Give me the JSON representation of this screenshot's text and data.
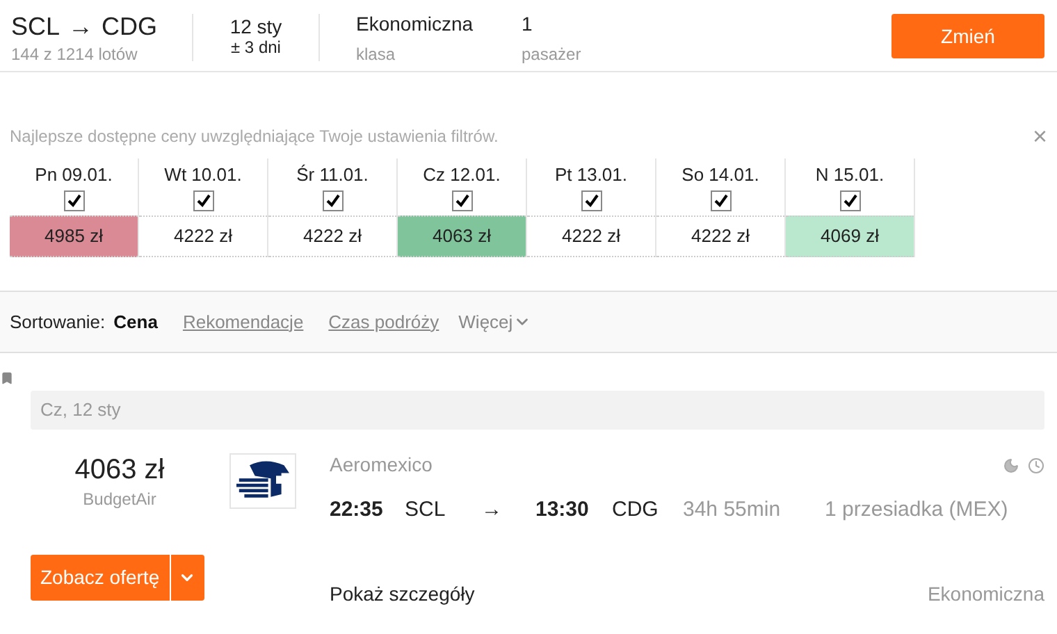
{
  "search_summary": {
    "route": {
      "from": "SCL",
      "arrow": "→",
      "to": "CDG",
      "count": "144 z 1214 lotów"
    },
    "date": {
      "value": "12 sty",
      "flex": "± 3 dni"
    },
    "cabin": {
      "value": "Ekonomiczna",
      "label": "klasa"
    },
    "passengers": {
      "value": "1",
      "label": "pasażer"
    },
    "change_button": "Zmień"
  },
  "price_calendar": {
    "note": "Najlepsze dostępne ceny uwzględniające Twoje ustawienia filtrów.",
    "close": "×",
    "days": [
      {
        "label": "Pn 09.01.",
        "checked": true,
        "price": "4985 zł",
        "color": "#d98a94"
      },
      {
        "label": "Wt 10.01.",
        "checked": true,
        "price": "4222 zł",
        "color": "#ffffff"
      },
      {
        "label": "Śr 11.01.",
        "checked": true,
        "price": "4222 zł",
        "color": "#ffffff"
      },
      {
        "label": "Cz 12.01.",
        "checked": true,
        "price": "4063 zł",
        "color": "#80c49c"
      },
      {
        "label": "Pt 13.01.",
        "checked": true,
        "price": "4222 zł",
        "color": "#ffffff"
      },
      {
        "label": "So 14.01.",
        "checked": true,
        "price": "4222 zł",
        "color": "#ffffff"
      },
      {
        "label": "N 15.01.",
        "checked": true,
        "price": "4069 zł",
        "color": "#b9e8cf"
      }
    ]
  },
  "sorting": {
    "label": "Sortowanie:",
    "options": [
      {
        "label": "Cena",
        "selected": true
      },
      {
        "label": "Rekomendacje",
        "selected": false
      },
      {
        "label": "Czas podróży",
        "selected": false
      }
    ],
    "more": "Więcej"
  },
  "result": {
    "date": "Cz, 12 sty",
    "price": "4063 zł",
    "agent": "BudgetAir",
    "airline": "Aeromexico",
    "departure_time": "22:35",
    "departure_airport": "SCL",
    "arrow": "→",
    "arrival_time": "13:30",
    "arrival_airport": "CDG",
    "duration": "34h 55min",
    "stops": "1 przesiadka (MEX)",
    "offer_button": "Zobacz ofertę",
    "details_link": "Pokaż szczegóły",
    "cabin": "Ekonomiczna"
  }
}
